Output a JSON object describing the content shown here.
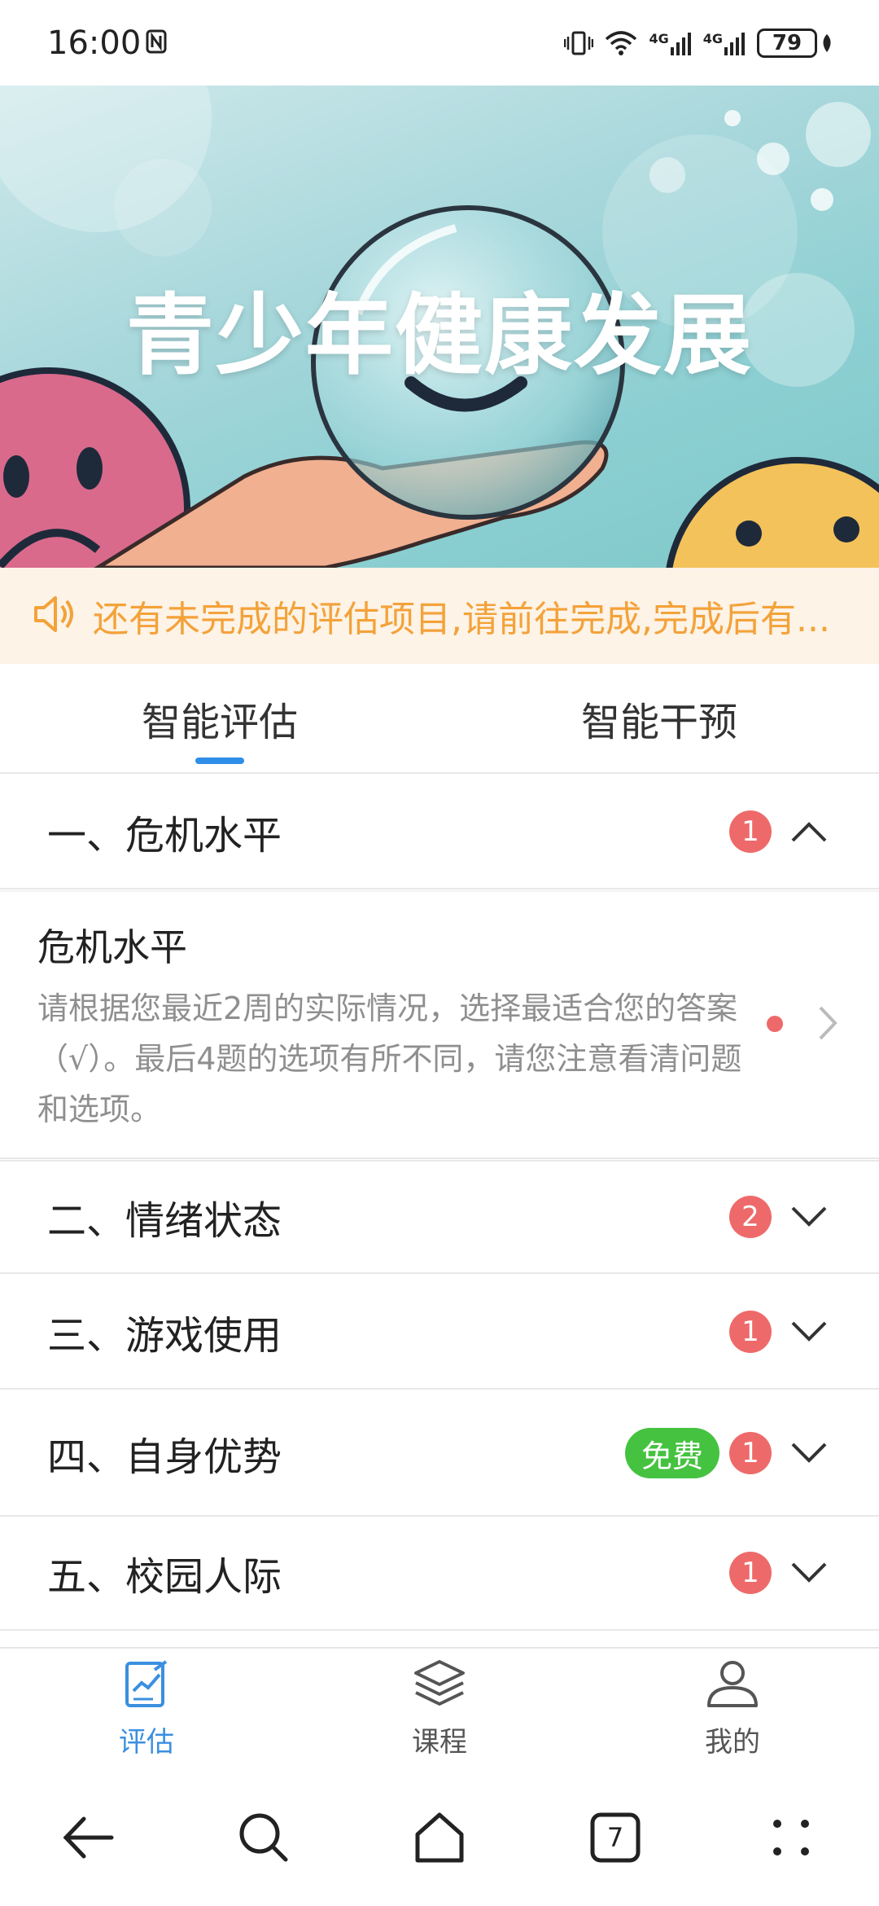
{
  "status_bar": {
    "time": "16:00",
    "network_1": "4G",
    "network_2": "4G",
    "battery": "79"
  },
  "banner": {
    "title": "青少年健康发展"
  },
  "notice": {
    "text": "还有未完成的评估项目,请前往完成,完成后有..."
  },
  "tabs": [
    {
      "label": "智能评估",
      "active": true
    },
    {
      "label": "智能干预",
      "active": false
    }
  ],
  "sections": [
    {
      "title": "一、危机水平",
      "count": "1",
      "expanded": true
    },
    {
      "title": "二、情绪状态",
      "count": "2",
      "expanded": false
    },
    {
      "title": "三、游戏使用",
      "count": "1",
      "expanded": false
    },
    {
      "title": "四、自身优势",
      "count": "1",
      "free_label": "免费",
      "expanded": false
    },
    {
      "title": "五、校园人际",
      "count": "1",
      "expanded": false
    }
  ],
  "sub_item": {
    "title": "危机水平",
    "description": "请根据您最近2周的实际情况，选择最适合您的答案（√）。最后4题的选项有所不同，请您注意看清问题和选项。"
  },
  "bottom_nav": [
    {
      "label": "评估",
      "active": true
    },
    {
      "label": "课程"
    },
    {
      "label": "我的"
    }
  ],
  "system_nav": {
    "tab_count": "7"
  },
  "colors": {
    "accent": "#2e8ee8",
    "badge": "#ee6a6a",
    "free": "#45c240",
    "notice_text": "#f3a23a"
  }
}
